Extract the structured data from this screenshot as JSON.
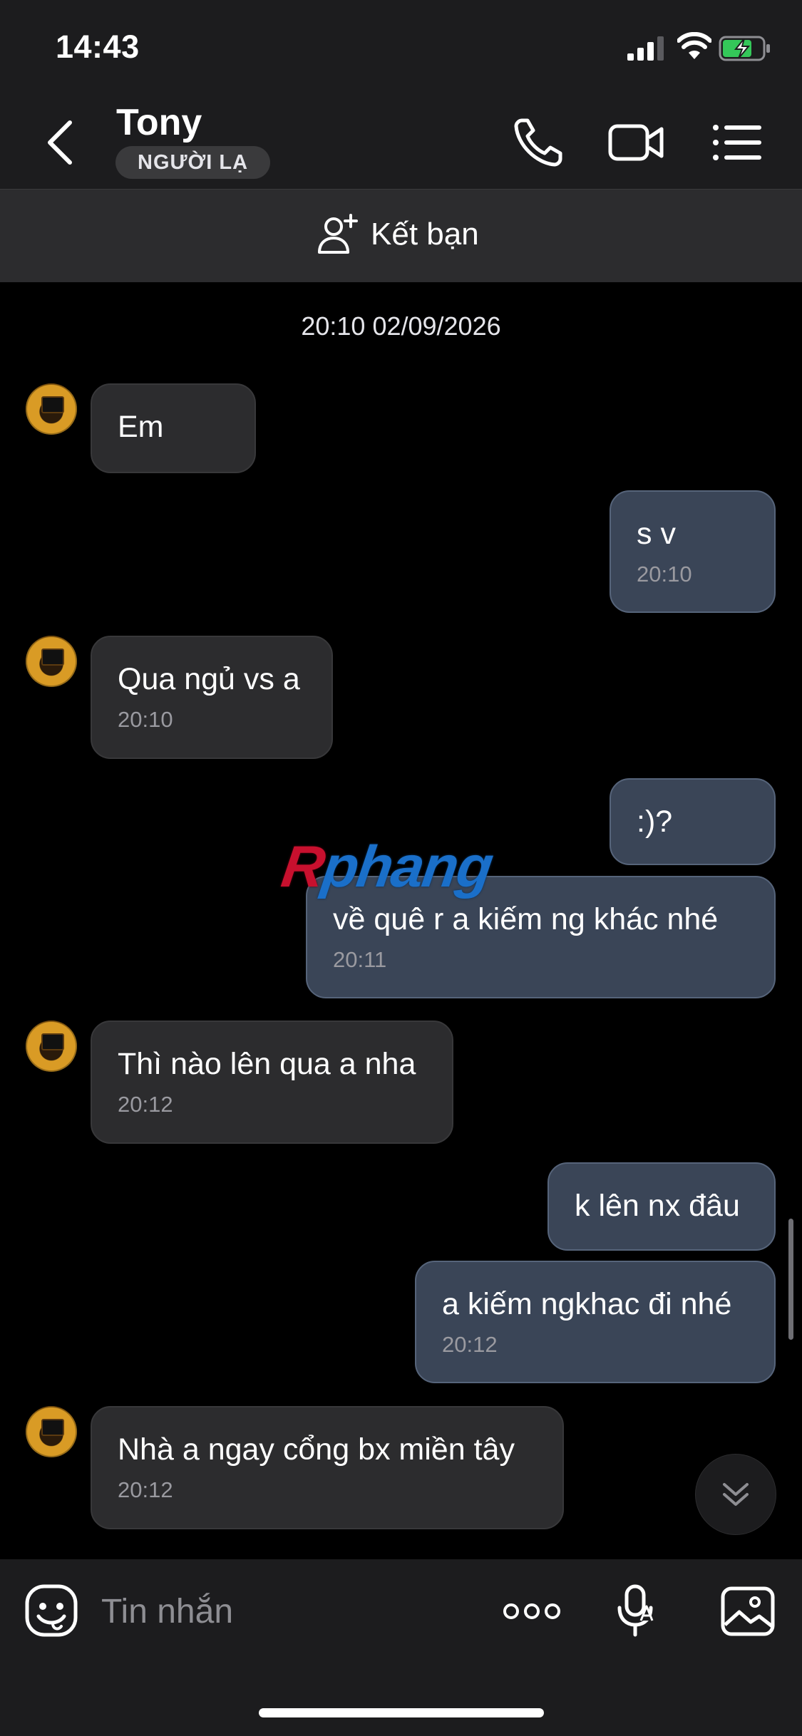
{
  "status_bar": {
    "time": "14:43"
  },
  "header": {
    "contact_name": "Tony",
    "badge": "NGƯỜI LẠ"
  },
  "friend_banner": {
    "label": "Kết bạn"
  },
  "chat": {
    "date_separator": "20:10 02/09/2026",
    "messages": [
      {
        "side": "in",
        "text": "Em"
      },
      {
        "side": "out",
        "text": "s v",
        "time": "20:10"
      },
      {
        "side": "in",
        "text": "Qua ngủ vs a",
        "time": "20:10"
      },
      {
        "side": "out",
        "text": ":)?"
      },
      {
        "side": "out",
        "text": "về quê r a  kiếm ng khác nhé",
        "time": "20:11"
      },
      {
        "side": "in",
        "text": "Thì nào lên qua a nha",
        "time": "20:12"
      },
      {
        "side": "out",
        "text": "k lên nx đâu"
      },
      {
        "side": "out",
        "text": "a kiếm ngkhac đi nhé",
        "time": "20:12"
      },
      {
        "side": "in",
        "text": "Nhà a ngay cổng bx miền tây",
        "time": "20:12"
      }
    ]
  },
  "watermark": {
    "part1": "R",
    "part2": "phang"
  },
  "input_bar": {
    "placeholder": "Tin nhắn"
  },
  "icons": {
    "back": "chevron-left-icon",
    "call": "phone-icon",
    "video": "video-camera-icon",
    "menu": "list-icon",
    "add_friend": "add-user-icon",
    "emoji": "sticker-icon",
    "more": "ellipsis-icon",
    "voice": "microphone-icon",
    "image": "image-icon",
    "scroll_down": "double-chevron-down-icon"
  }
}
